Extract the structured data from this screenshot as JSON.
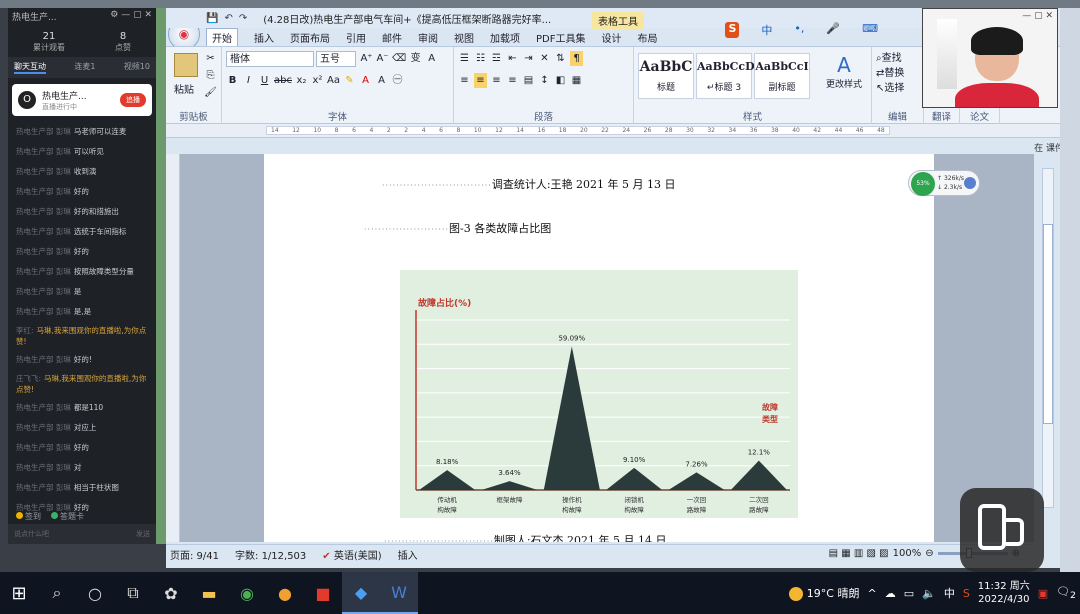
{
  "chat": {
    "header_title": "热电生产...",
    "stats": [
      {
        "value": "21",
        "label": "累计观看"
      },
      {
        "value": "8",
        "label": "点赞"
      }
    ],
    "tabs": [
      "聊天互动",
      "连麦1",
      "视频10"
    ],
    "card_title": "热电生产...",
    "card_sub": "直播进行中",
    "card_button": "追播",
    "messages": [
      {
        "name": "热电生产部 彭琳",
        "text": "马老师可以连麦",
        "highlight": false
      },
      {
        "name": "热电生产部 彭琳",
        "text": "可以听见",
        "highlight": false
      },
      {
        "name": "热电生产部 彭琳",
        "text": "收到演",
        "highlight": false
      },
      {
        "name": "热电生产部 彭琳",
        "text": "好的",
        "highlight": false
      },
      {
        "name": "热电生产部 彭琳",
        "text": "好的和措施出",
        "highlight": false
      },
      {
        "name": "热电生产部 彭琳",
        "text": "选统于车间指标",
        "highlight": false
      },
      {
        "name": "热电生产部 彭琳",
        "text": "好的",
        "highlight": false
      },
      {
        "name": "热电生产部 彭琳",
        "text": "按照故障类型分量",
        "highlight": false
      },
      {
        "name": "热电生产部 彭琳",
        "text": "是",
        "highlight": false
      },
      {
        "name": "热电生产部 彭琳",
        "text": "是,是",
        "highlight": false
      },
      {
        "name": "李红:",
        "text": "马琳,我来围观你的直播啦,为你点赞!",
        "highlight": true
      },
      {
        "name": "热电生产部 彭琳",
        "text": "好的!",
        "highlight": false
      },
      {
        "name": "庄飞飞:",
        "text": "马琳,我来围观你的直播啦,为你点赞!",
        "highlight": true
      },
      {
        "name": "热电生产部 彭琳",
        "text": "都是110",
        "highlight": false
      },
      {
        "name": "热电生产部 彭琳",
        "text": "对应上",
        "highlight": false
      },
      {
        "name": "热电生产部 彭琳",
        "text": "好的",
        "highlight": false
      },
      {
        "name": "热电生产部 彭琳",
        "text": "对",
        "highlight": false
      },
      {
        "name": "热电生产部 彭琳",
        "text": "相当于柱状图",
        "highlight": false
      },
      {
        "name": "热电生产部 彭琳",
        "text": "好的",
        "highlight": false
      }
    ],
    "footer": [
      "签到",
      "答题卡"
    ],
    "input_placeholder": "说点什么吧",
    "send_label": "发送"
  },
  "word": {
    "title": "(4.28日改)热电生产部电气车间+《提高低压框架断路器完好率...",
    "context_tab": "表格工具",
    "menu": [
      "开始",
      "插入",
      "页面布局",
      "引用",
      "邮件",
      "审阅",
      "视图",
      "加载项",
      "PDF工具集",
      "设计",
      "布局"
    ],
    "ime": {
      "logo": "S",
      "lang": "中"
    },
    "ribbon": {
      "paste": "粘贴",
      "font_name": "楷体",
      "font_size": "五号",
      "styles": [
        {
          "preview": "AaBbC",
          "name": "标题"
        },
        {
          "preview": "AaBbCcD",
          "name": "↵标题 3"
        },
        {
          "preview": "AaBbCcI",
          "name": "副标题"
        }
      ],
      "change_style": "更改样式",
      "edit": [
        "查找",
        "替换",
        "选择"
      ],
      "groups": [
        "剪贴板",
        "字体",
        "段落",
        "样式",
        "编辑",
        "翻译",
        "论文"
      ]
    },
    "side_label": "在 课件",
    "doc": {
      "line1": "调查统计人:王艳 2021 年 5 月 13 日",
      "line2": "图-3 各类故障占比图",
      "line3": "制图人:石文杰 2021 年 5 月 14 日"
    },
    "status": {
      "page": "页面: 9/41",
      "words": "字数: 1/12,503",
      "lang": "英语(美国)",
      "mode": "插入",
      "zoom": "100%"
    }
  },
  "widget": {
    "pct": "53%",
    "up": "326k/s",
    "down": "2.3k/s"
  },
  "chart_data": {
    "type": "bar",
    "title": "故障占比(%)",
    "legend_label": "故障类型",
    "categories": [
      "传动机构故障",
      "框架故障",
      "操作机构故障",
      "闭锁机构故障",
      "一次回路故障",
      "二次回路故障"
    ],
    "values": [
      8.18,
      3.64,
      59.09,
      9.1,
      7.26,
      12.1
    ],
    "labels": [
      "8.18%",
      "3.64%",
      "59.09%",
      "9.10%",
      "7.26%",
      "12.1%"
    ],
    "ylim": [
      0,
      70
    ],
    "bar_color": "#2b3a3a",
    "background": "#e1efe1",
    "accent": "#c0392b"
  },
  "taskbar": {
    "weather": "19°C 晴朗",
    "ime": "中",
    "time": "11:32 周六",
    "date": "2022/4/30",
    "notifications": "2"
  }
}
